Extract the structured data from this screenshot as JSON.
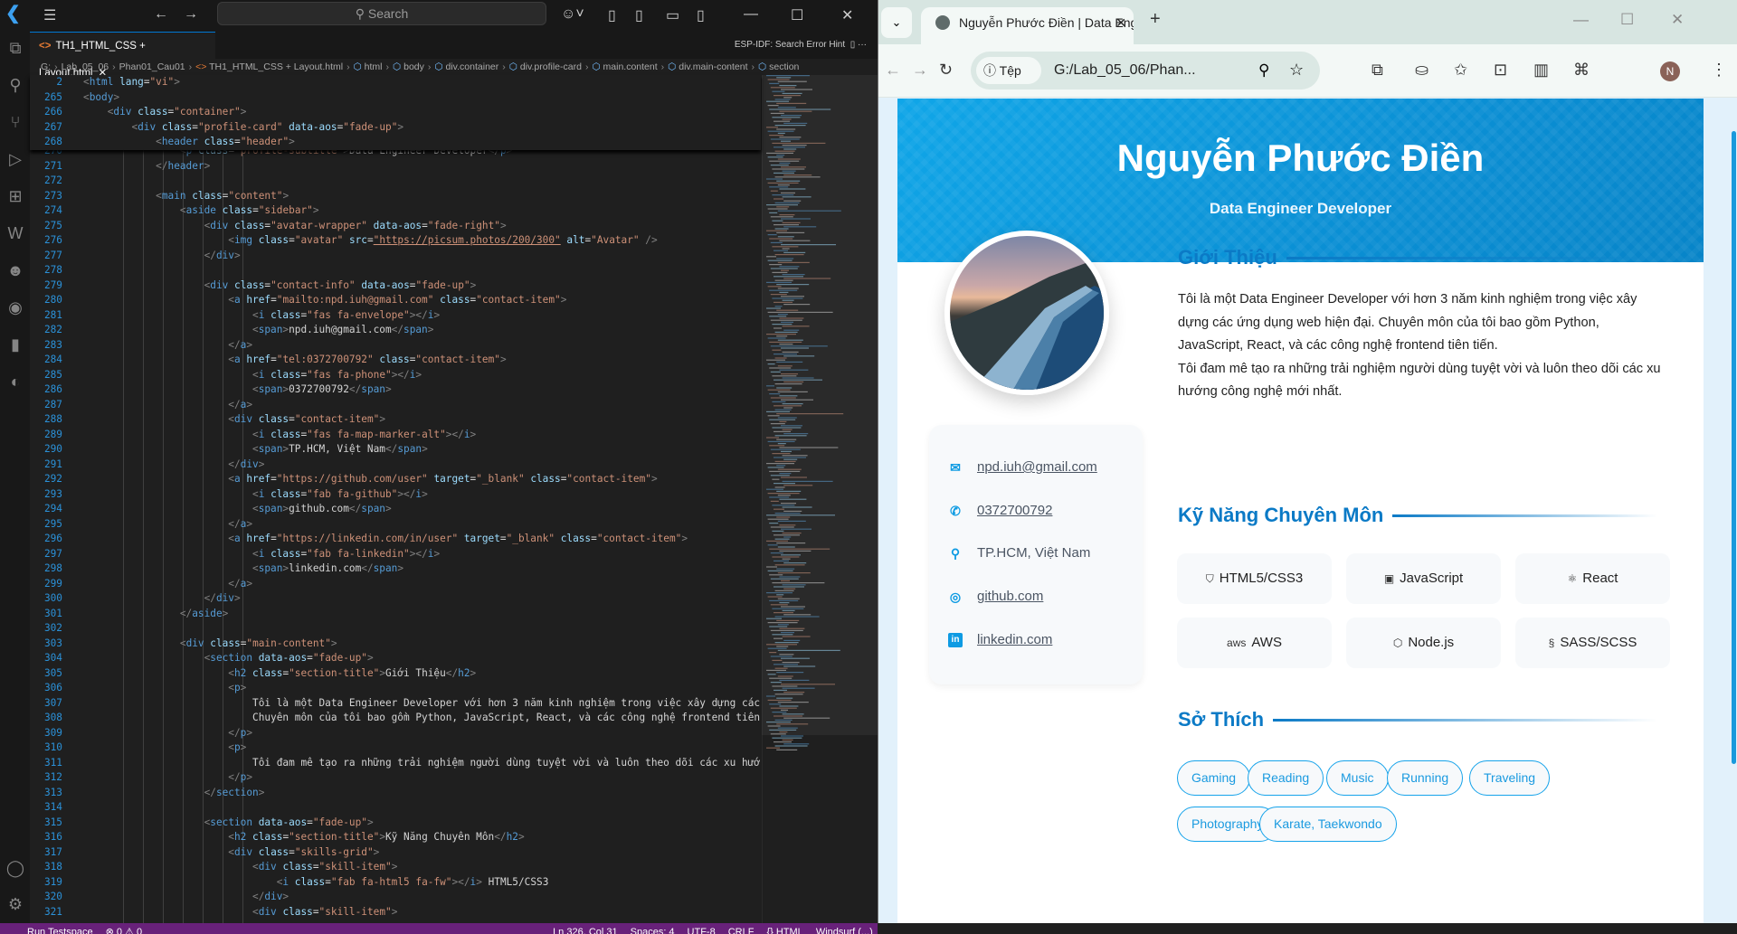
{
  "vscode": {
    "search_placeholder": "Search",
    "tab_label": "TH1_HTML_CSS + Layout.html",
    "hint": "ESP-IDF: Search Error Hint",
    "breadcrumb": [
      "G:",
      "Lab_05_06",
      "Phan01_Cau01",
      "TH1_HTML_CSS + Layout.html",
      "html",
      "body",
      "div.container",
      "div.profile-card",
      "main.content",
      "div.main-content",
      "section"
    ],
    "sticky_lines": [
      {
        "n": "2",
        "t": "<html lang=\"vi\">"
      },
      {
        "n": "265",
        "t": "<body>"
      },
      {
        "n": "266",
        "t": "    <div class=\"container\">"
      },
      {
        "n": "267",
        "t": "        <div class=\"profile-card\" data-aos=\"fade-up\">"
      },
      {
        "n": "268",
        "t": "            <header class=\"header\">"
      }
    ],
    "lines": [
      {
        "n": "270",
        "t": "                <p class=\"profile-subtitle\">Data Engineer Developer</p>"
      },
      {
        "n": "271",
        "t": "            </header>"
      },
      {
        "n": "272",
        "t": ""
      },
      {
        "n": "273",
        "t": "            <main class=\"content\">"
      },
      {
        "n": "274",
        "t": "                <aside class=\"sidebar\">"
      },
      {
        "n": "275",
        "t": "                    <div class=\"avatar-wrapper\" data-aos=\"fade-right\">"
      },
      {
        "n": "276",
        "t": "                        <img class=\"avatar\" src=\"https://picsum.photos/200/300\" alt=\"Avatar\" />"
      },
      {
        "n": "277",
        "t": "                    </div>"
      },
      {
        "n": "278",
        "t": ""
      },
      {
        "n": "279",
        "t": "                    <div class=\"contact-info\" data-aos=\"fade-up\">"
      },
      {
        "n": "280",
        "t": "                        <a href=\"mailto:npd.iuh@gmail.com\" class=\"contact-item\">"
      },
      {
        "n": "281",
        "t": "                            <i class=\"fas fa-envelope\"></i>"
      },
      {
        "n": "282",
        "t": "                            <span>npd.iuh@gmail.com</span>"
      },
      {
        "n": "283",
        "t": "                        </a>"
      },
      {
        "n": "284",
        "t": "                        <a href=\"tel:0372700792\" class=\"contact-item\">"
      },
      {
        "n": "285",
        "t": "                            <i class=\"fas fa-phone\"></i>"
      },
      {
        "n": "286",
        "t": "                            <span>0372700792</span>"
      },
      {
        "n": "287",
        "t": "                        </a>"
      },
      {
        "n": "288",
        "t": "                        <div class=\"contact-item\">"
      },
      {
        "n": "289",
        "t": "                            <i class=\"fas fa-map-marker-alt\"></i>"
      },
      {
        "n": "290",
        "t": "                            <span>TP.HCM, Việt Nam</span>"
      },
      {
        "n": "291",
        "t": "                        </div>"
      },
      {
        "n": "292",
        "t": "                        <a href=\"https://github.com/user\" target=\"_blank\" class=\"contact-item\">"
      },
      {
        "n": "293",
        "t": "                            <i class=\"fab fa-github\"></i>"
      },
      {
        "n": "294",
        "t": "                            <span>github.com</span>"
      },
      {
        "n": "295",
        "t": "                        </a>"
      },
      {
        "n": "296",
        "t": "                        <a href=\"https://linkedin.com/in/user\" target=\"_blank\" class=\"contact-item\">"
      },
      {
        "n": "297",
        "t": "                            <i class=\"fab fa-linkedin\"></i>"
      },
      {
        "n": "298",
        "t": "                            <span>linkedin.com</span>"
      },
      {
        "n": "299",
        "t": "                        </a>"
      },
      {
        "n": "300",
        "t": "                    </div>"
      },
      {
        "n": "301",
        "t": "                </aside>"
      },
      {
        "n": "302",
        "t": ""
      },
      {
        "n": "303",
        "t": "                <div class=\"main-content\">"
      },
      {
        "n": "304",
        "t": "                    <section data-aos=\"fade-up\">"
      },
      {
        "n": "305",
        "t": "                        <h2 class=\"section-title\">Giới Thiệu</h2>"
      },
      {
        "n": "306",
        "t": "                        <p>"
      },
      {
        "n": "307",
        "t": "                            Tôi là một Data Engineer Developer với hơn 3 năm kinh nghiệm trong việc xây dựng các"
      },
      {
        "n": "308",
        "t": "                            Chuyên môn của tôi bao gồm Python, JavaScript, React, và các công nghệ frontend tiên"
      },
      {
        "n": "309",
        "t": "                        </p>"
      },
      {
        "n": "310",
        "t": "                        <p>"
      },
      {
        "n": "311",
        "t": "                            Tôi đam mê tạo ra những trải nghiệm người dùng tuyệt vời và luôn theo dõi các xu hướ"
      },
      {
        "n": "312",
        "t": "                        </p>"
      },
      {
        "n": "313",
        "t": "                    </section>"
      },
      {
        "n": "314",
        "t": ""
      },
      {
        "n": "315",
        "t": "                    <section data-aos=\"fade-up\">"
      },
      {
        "n": "316",
        "t": "                        <h2 class=\"section-title\">Kỹ Năng Chuyên Môn</h2>"
      },
      {
        "n": "317",
        "t": "                        <div class=\"skills-grid\">"
      },
      {
        "n": "318",
        "t": "                            <div class=\"skill-item\">"
      },
      {
        "n": "319",
        "t": "                                <i class=\"fab fa-html5 fa-fw\"></i> HTML5/CSS3"
      },
      {
        "n": "320",
        "t": "                            </div>"
      },
      {
        "n": "321",
        "t": "                            <div class=\"skill-item\">"
      }
    ],
    "status": [
      "Run Testspace",
      "⊗ 0 ⚠ 0",
      "Ln 326, Col 31",
      "Spaces: 4",
      "UTF-8",
      "CRLF",
      "{} HTML",
      "Windsurf (...)"
    ]
  },
  "browser": {
    "tab_title": "Nguyễn Phước Điền | Data Engi",
    "site_info_label": "Tệp",
    "url": "G:/Lab_05_06/Phan...",
    "profile_initial": "N",
    "accent": "#0b7ac6"
  },
  "profile": {
    "name": "Nguyễn Phước Điền",
    "subtitle": "Data Engineer Developer",
    "contacts": [
      {
        "icon": "envelope-icon",
        "text": "npd.iuh@gmail.com",
        "link": true
      },
      {
        "icon": "phone-icon",
        "text": "0372700792",
        "link": true
      },
      {
        "icon": "map-marker-icon",
        "text": "TP.HCM, Việt Nam",
        "link": false
      },
      {
        "icon": "github-icon",
        "text": "github.com",
        "link": true
      },
      {
        "icon": "linkedin-icon",
        "text": "linkedin.com",
        "link": true
      }
    ],
    "about_title": "Giới Thiệu",
    "about_p1": "Tôi là một Data Engineer Developer với hơn 3 năm kinh nghiệm trong việc xây dựng các ứng dụng web hiện đại. Chuyên môn của tôi bao gồm Python, JavaScript, React, và các công nghệ frontend tiên tiến.",
    "about_p2": "Tôi đam mê tạo ra những trải nghiệm người dùng tuyệt vời và luôn theo dõi các xu hướng công nghệ mới nhất.",
    "skills_title": "Kỹ Năng Chuyên Môn",
    "skills": [
      {
        "icon": "html5-icon",
        "label": "HTML5/CSS3"
      },
      {
        "icon": "javascript-icon",
        "label": "JavaScript"
      },
      {
        "icon": "react-icon",
        "label": "React"
      },
      {
        "icon": "aws-icon",
        "label": "AWS"
      },
      {
        "icon": "nodejs-icon",
        "label": "Node.js"
      },
      {
        "icon": "sass-icon",
        "label": "SASS/SCSS"
      }
    ],
    "hobbies_title": "Sở Thích",
    "hobbies": [
      "Gaming",
      "Reading",
      "Music",
      "Running",
      "Traveling",
      "Photography",
      "Karate, Taekwondo"
    ]
  }
}
